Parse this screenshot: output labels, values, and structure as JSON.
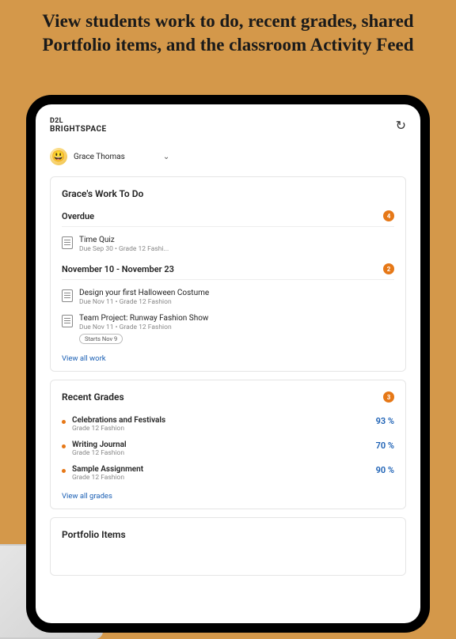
{
  "promo": {
    "title": "View students work to do, recent grades, shared Portfolio items, and the classroom Activity Feed"
  },
  "brand": {
    "top": "D2L",
    "name": "BRIGHTSPACE"
  },
  "student": {
    "name": "Grace Thomas"
  },
  "work": {
    "title": "Grace's Work To Do",
    "overdue": {
      "label": "Overdue",
      "count": "4",
      "items": [
        {
          "title": "Time Quiz",
          "meta": "Due Sep 30 • Grade 12 Fashi..."
        }
      ]
    },
    "upcoming": {
      "label": "November 10 - November 23",
      "count": "2",
      "items": [
        {
          "title": "Design your first Halloween Costume",
          "meta": "Due Nov 11 • Grade 12 Fashion",
          "chip": ""
        },
        {
          "title": "Team Project: Runway Fashion Show",
          "meta": "Due Nov 11 • Grade 12 Fashion",
          "chip": "Starts Nov 9"
        }
      ]
    },
    "link": "View all work"
  },
  "grades": {
    "title": "Recent Grades",
    "count": "3",
    "items": [
      {
        "title": "Celebrations and Festivals",
        "sub": "Grade 12 Fashion",
        "pct": "93 %"
      },
      {
        "title": "Writing Journal",
        "sub": "Grade 12 Fashion",
        "pct": "70 %"
      },
      {
        "title": "Sample Assignment",
        "sub": "Grade 12 Fashion",
        "pct": "90 %"
      }
    ],
    "link": "View all grades"
  },
  "portfolio": {
    "title": "Portfolio Items"
  }
}
